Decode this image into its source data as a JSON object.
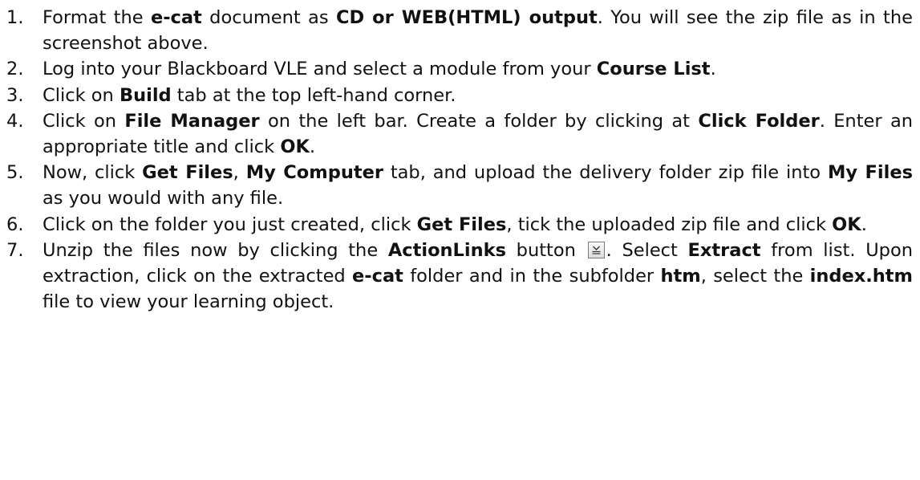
{
  "steps": [
    {
      "num": "1.",
      "parts": [
        "Format the ",
        "e-cat",
        " document as ",
        "CD or WEB(HTML) output",
        ". You will see the zip file as in the screenshot above."
      ]
    },
    {
      "num": "2.",
      "parts": [
        "Log into your Blackboard VLE and select a module from your ",
        "Course List",
        "."
      ]
    },
    {
      "num": "3.",
      "parts": [
        "Click on ",
        "Build",
        " tab at the top left-hand corner."
      ]
    },
    {
      "num": "4.",
      "parts": [
        "Click on ",
        "File Manager",
        " on the left bar.  Create a folder by clicking at ",
        "Click Folder",
        ".  Enter an appropriate title and click ",
        "OK",
        "."
      ]
    },
    {
      "num": "5.",
      "parts": [
        "Now, click ",
        "Get Files",
        ", ",
        "My Computer",
        " tab, and upload the delivery folder zip file into ",
        "My Files",
        " as you would with any file."
      ]
    },
    {
      "num": "6.",
      "parts": [
        "Click on the folder you just created, click ",
        "Get Files",
        ", tick the uploaded zip file and click ",
        "OK",
        "."
      ]
    },
    {
      "num": "7.",
      "parts": [
        "Unzip the files now by clicking the ",
        "ActionLinks",
        " button ",
        ".  Select ",
        "Extract",
        " from list.  Upon extraction, click on the extracted ",
        "e-cat",
        " folder and in the subfolder ",
        "htm",
        ", select the ",
        "index.htm",
        " file to view your learning object."
      ]
    }
  ]
}
